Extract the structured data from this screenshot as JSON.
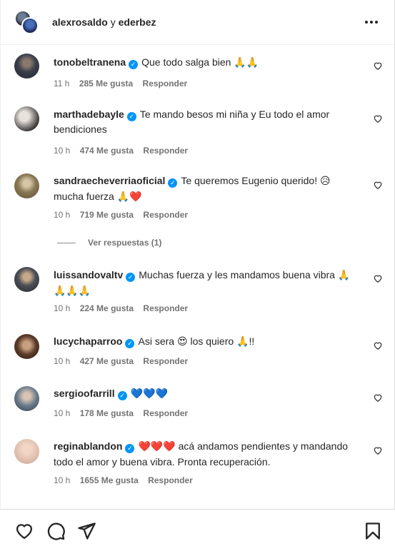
{
  "header": {
    "user1": "alexrosaldo",
    "connector": "y",
    "user2": "ederbez"
  },
  "comments": [
    {
      "user": "tonobeltranena",
      "text": "Que todo salga bien",
      "emoji": "🙏🙏",
      "time": "11 h",
      "likes": "285 Me gusta",
      "reply": "Responder"
    },
    {
      "user": "marthadebayle",
      "text": "Te mando besos mi niña y Eu todo el amor bendiciones",
      "emoji": "",
      "time": "10 h",
      "likes": "474 Me gusta",
      "reply": "Responder"
    },
    {
      "user": "sandraecheverriaoficial",
      "text": "Te queremos Eugenio querido!",
      "emoji": "😥",
      "text2": "mucha fuerza",
      "emoji2": "🙏❤️",
      "time": "10 h",
      "likes": "719 Me gusta",
      "reply": "Responder"
    },
    {
      "user": "luissandovaltv",
      "text": "Muchas fuerza y les mandamos buena vibra",
      "emoji": "🙏🙏🙏🙏",
      "time": "10 h",
      "likes": "224 Me gusta",
      "reply": "Responder"
    },
    {
      "user": "lucychaparroo",
      "text": "Asi sera",
      "emoji": "😍",
      "text2": "los quiero",
      "emoji2": "🙏",
      "text3": "!!",
      "time": "10 h",
      "likes": "427 Me gusta",
      "reply": "Responder"
    },
    {
      "user": "sergioofarrill",
      "text": "",
      "emoji": "💙💙💙",
      "time": "10 h",
      "likes": "178 Me gusta",
      "reply": "Responder"
    },
    {
      "user": "reginablandon",
      "text": "",
      "emoji": "❤️❤️❤️",
      "text2": "acá andamos pendientes y mandando todo el amor y buena vibra. Pronta recuperación.",
      "time": "10 h",
      "likes": "1655 Me gusta",
      "reply": "Responder"
    }
  ],
  "view_replies": "Ver respuestas (1)",
  "icons": {
    "verified": "verified-badge-icon",
    "like": "heart-outline-icon",
    "comment": "comment-bubble-icon",
    "share": "paper-plane-icon",
    "save": "bookmark-icon",
    "more": "more-options-icon"
  },
  "colors": {
    "text": "#262626",
    "secondary": "#737373",
    "verified": "#0095f6",
    "border": "#dbdbdb"
  }
}
